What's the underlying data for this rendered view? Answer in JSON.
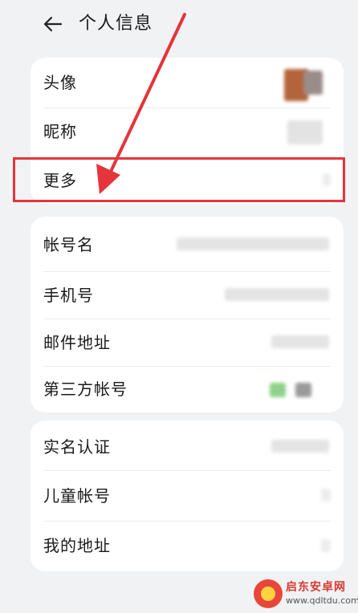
{
  "header": {
    "title": "个人信息",
    "back_icon": "back-arrow-icon"
  },
  "section1": [
    {
      "label": "头像"
    },
    {
      "label": "昵称"
    },
    {
      "label": "更多"
    }
  ],
  "section2": [
    {
      "label": "帐号名"
    },
    {
      "label": "手机号"
    },
    {
      "label": "邮件地址"
    },
    {
      "label": "第三方帐号"
    }
  ],
  "section3": [
    {
      "label": "实名认证"
    },
    {
      "label": "儿童帐号"
    },
    {
      "label": "我的地址"
    }
  ],
  "annotation": {
    "highlight_color": "#e5343c",
    "target": "更多"
  },
  "watermark": {
    "brand": "启东安卓网",
    "url": "www.qdltdu.com"
  }
}
